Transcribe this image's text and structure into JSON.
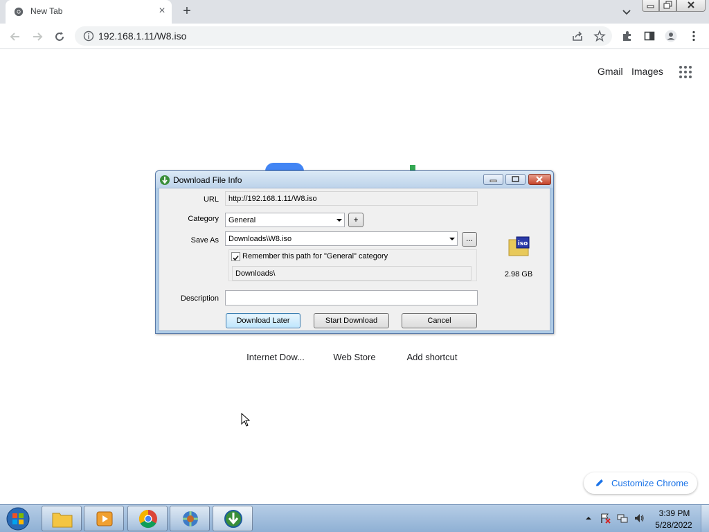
{
  "browser": {
    "tab_title": "New Tab",
    "url": "192.168.1.11/W8.iso"
  },
  "ntp": {
    "gmail": "Gmail",
    "images": "Images",
    "shortcuts": [
      "Internet Dow...",
      "Web Store",
      "Add shortcut"
    ],
    "customize": "Customize Chrome"
  },
  "dialog": {
    "title": "Download File Info",
    "url_label": "URL",
    "url_value": "http://192.168.1.11/W8.iso",
    "category_label": "Category",
    "category_value": "General",
    "add_category": "+",
    "saveas_label": "Save As",
    "saveas_value": "Downloads\\W8.iso",
    "browse": "...",
    "remember_label": "Remember this path for \"General\" category",
    "remember_checked": true,
    "path_value": "Downloads\\",
    "description_label": "Description",
    "description_value": "",
    "file_size": "2.98  GB",
    "file_type_icon": "iso-file-icon",
    "buttons": {
      "download_later": "Download Later",
      "start_download": "Start Download",
      "cancel": "Cancel"
    }
  },
  "taskbar": {
    "time": "3:39 PM",
    "date": "5/28/2022"
  }
}
